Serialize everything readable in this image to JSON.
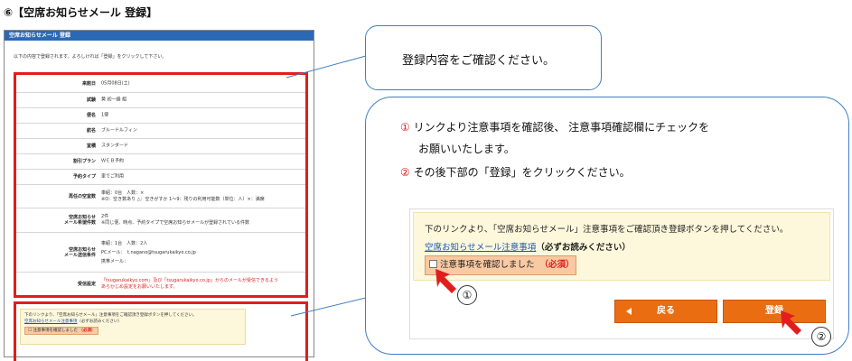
{
  "heading": "⑥【空席お知らせメール 登録】",
  "mini": {
    "title_bar": "空席お知らせメール 登録",
    "intro": "以下の内容で登録されます。よろしければ「登録」をクリックして下さい。",
    "rows": [
      {
        "label": "来館日",
        "value": "05月08日(土)"
      },
      {
        "label": "試験",
        "value": "黄 初一級 組"
      },
      {
        "label": "便名",
        "value": "1便"
      },
      {
        "label": "航名",
        "value": "ブルードルフィン"
      },
      {
        "label": "室積",
        "value": "スタンダード"
      },
      {
        "label": "割引プラン",
        "value": "ＷＥＢ予約"
      },
      {
        "label": "予約タイプ",
        "value": "車でご利用"
      },
      {
        "label": "再任の空室数",
        "value": "車紹：0台　人数：×",
        "value2": "※O：空き数あり △：空きがすか 1～9：残りの利用可能数（単位：人）×：満席"
      },
      {
        "label": "空席お知らせ\nメール希望件数",
        "value": "2件",
        "value2": "※同じ便、時点、予約タイプで空席お知らせメールが登録されている件数"
      },
      {
        "label": "空席お知らせ\nメール送信条件",
        "value": "車紹：1台　人数：2人",
        "value2": "PCメール：　t.nagano@tsugarukaikyo.co.jp",
        "value3": "携帯メール："
      },
      {
        "label": "受信設定",
        "value": "「tsugarukaikyo.com」及び「tsugarukaikyo.co.jp」からのメールが受信できるよう",
        "value2": "あらかじめ設定をお願いいたします。"
      }
    ],
    "notice_desc": "下のリンクより、「空席お知らせメール」注意事項をご確認頂き登録ボタンを押してください。",
    "notice_link": "空席お知らせメール注意事項",
    "notice_must": "（必ずお読みください）",
    "check_label": "注意事項を確認しました",
    "check_req": "（必須）",
    "back_label": "戻る",
    "register_label": "登録"
  },
  "callout_a": {
    "text": "登録内容をご確認ください。"
  },
  "callout_b": {
    "step1_num": "①",
    "step1_line1": "リンクより注意事項を確認後、 注意事項確認欄にチェックを",
    "step1_line2": "お願いいたします。",
    "step2_num": "②",
    "step2_line": "その後下部の「登録」をクリックください。"
  },
  "zoom": {
    "desc": "下のリンクより、「空席お知らせメール」注意事項をご確認頂き登録ボタンを押してください。",
    "link": "空席お知らせメール注意事項",
    "must": "（必ずお読みください）",
    "check_label": "注意事項を確認しました",
    "check_req": "（必須）",
    "back_label": "戻る",
    "register_label": "登録"
  },
  "markers": {
    "one": "①",
    "two": "②"
  },
  "colors": {
    "highlight_red": "#e21d1d",
    "button_orange": "#ea6d12",
    "callout_blue": "#3f7fc4",
    "header_blue": "#2c69b5",
    "notice_yellow": "#fdf8dc"
  },
  "icons": {
    "arrow": "red-pointer-arrow-icon",
    "back_triangle": "triangle-left-icon"
  }
}
